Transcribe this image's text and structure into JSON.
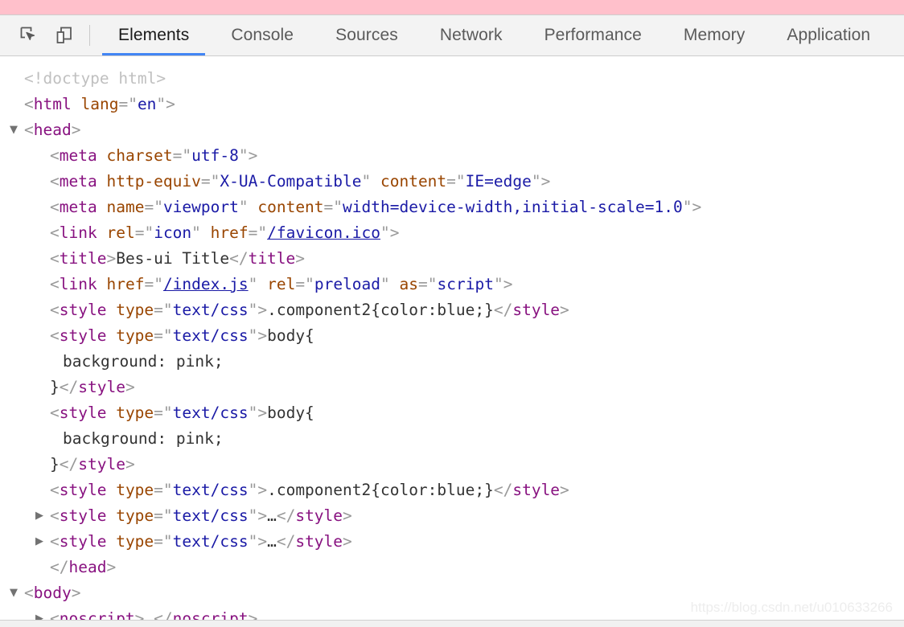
{
  "page": {
    "body_background_color": "#ffc0cb"
  },
  "toolbar": {
    "inspect_button_title": "Inspect element",
    "device_toolbar_button_title": "Toggle device toolbar",
    "tabs": [
      {
        "label": "Elements",
        "selected": true
      },
      {
        "label": "Console",
        "selected": false
      },
      {
        "label": "Sources",
        "selected": false
      },
      {
        "label": "Network",
        "selected": false
      },
      {
        "label": "Performance",
        "selected": false
      },
      {
        "label": "Memory",
        "selected": false
      },
      {
        "label": "Application",
        "selected": false
      }
    ],
    "accent_color": "#4285f4",
    "background_color": "#f3f3f3"
  },
  "dom_tree": {
    "lines": [
      {
        "id": "l1",
        "indent": 0,
        "twisty": "",
        "text": "<!doctype html>"
      },
      {
        "id": "l2",
        "indent": 0,
        "twisty": "",
        "text": "<html lang=\"en\">"
      },
      {
        "id": "l3",
        "indent": 0,
        "twisty": "▼",
        "text": "<head>"
      },
      {
        "id": "l4",
        "indent": 1,
        "twisty": "",
        "text": "<meta charset=\"utf-8\">"
      },
      {
        "id": "l5",
        "indent": 1,
        "twisty": "",
        "text": "<meta http-equiv=\"X-UA-Compatible\" content=\"IE=edge\">"
      },
      {
        "id": "l6",
        "indent": 1,
        "twisty": "",
        "text": "<meta name=\"viewport\" content=\"width=device-width,initial-scale=1.0\">"
      },
      {
        "id": "l7",
        "indent": 1,
        "twisty": "",
        "text": "<link rel=\"icon\" href=\"/favicon.ico\">"
      },
      {
        "id": "l8",
        "indent": 1,
        "twisty": "",
        "text": "<title>Bes-ui Title</title>"
      },
      {
        "id": "l9",
        "indent": 1,
        "twisty": "",
        "text": "<link href=\"/index.js\" rel=\"preload\" as=\"script\">"
      },
      {
        "id": "l10",
        "indent": 1,
        "twisty": "",
        "text": "<style type=\"text/css\">.component2{color:blue;}</style>"
      },
      {
        "id": "l11",
        "indent": 1,
        "twisty": "",
        "text": "<style type=\"text/css\">body{"
      },
      {
        "id": "l12",
        "indent": 2,
        "twisty": "",
        "text": "background: pink;"
      },
      {
        "id": "l13",
        "indent": 1,
        "twisty": "",
        "text": "}</style>"
      },
      {
        "id": "l14",
        "indent": 1,
        "twisty": "",
        "text": "<style type=\"text/css\">body{"
      },
      {
        "id": "l15",
        "indent": 2,
        "twisty": "",
        "text": "background: pink;"
      },
      {
        "id": "l16",
        "indent": 1,
        "twisty": "",
        "text": "}</style>"
      },
      {
        "id": "l17",
        "indent": 1,
        "twisty": "",
        "text": "<style type=\"text/css\">.component2{color:blue;}</style>"
      },
      {
        "id": "l18",
        "indent": 1,
        "twisty": "▶",
        "text": "<style type=\"text/css\">…</style>"
      },
      {
        "id": "l19",
        "indent": 1,
        "twisty": "▶",
        "text": "<style type=\"text/css\">…</style>"
      },
      {
        "id": "l20",
        "indent": 1,
        "twisty": "",
        "text": "</head>"
      },
      {
        "id": "l21",
        "indent": 0,
        "twisty": "▼",
        "text": "<body>"
      },
      {
        "id": "l22",
        "indent": 1,
        "twisty": "▶",
        "text": "<noscript>…</noscript>"
      }
    ]
  },
  "watermark": {
    "text": "https://blog.csdn.net/u010633266"
  }
}
